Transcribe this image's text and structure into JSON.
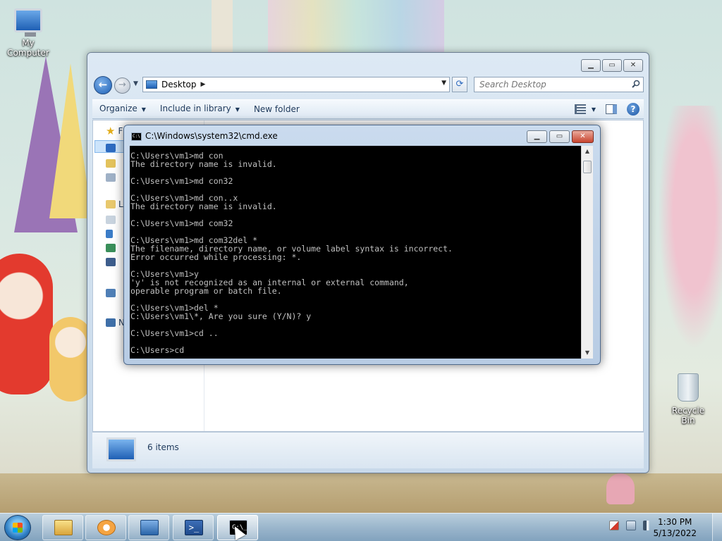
{
  "desktop": {
    "icons": [
      {
        "label": "My Computer",
        "icon": "computer-icon"
      },
      {
        "label": "Recycle Bin",
        "icon": "recycle-bin-icon"
      }
    ]
  },
  "explorer": {
    "address": {
      "location": "Desktop"
    },
    "search": {
      "placeholder": "Search Desktop"
    },
    "toolbar": {
      "organize": "Organize",
      "include_in_library": "Include in library",
      "new_folder": "New folder"
    },
    "navpane": {
      "favorites_letter": "F",
      "libraries_letter": "L",
      "network_letter": "N"
    },
    "details": {
      "item_count": "6 items"
    }
  },
  "cmd": {
    "title": "C:\\Windows\\system32\\cmd.exe",
    "output": "C:\\Users\\vm1>md con\nThe directory name is invalid.\n\nC:\\Users\\vm1>md con32\n\nC:\\Users\\vm1>md con..x\nThe directory name is invalid.\n\nC:\\Users\\vm1>md com32\n\nC:\\Users\\vm1>md com32del *\nThe filename, directory name, or volume label syntax is incorrect.\nError occurred while processing: *.\n\nC:\\Users\\vm1>y\n'y' is not recognized as an internal or external command,\noperable program or batch file.\n\nC:\\Users\\vm1>del *\nC:\\Users\\vm1\\*, Are you sure (Y/N)? y\n\nC:\\Users\\vm1>cd ..\n\nC:\\Users>cd"
  },
  "taskbar": {
    "apps": [
      {
        "name": "windows-explorer",
        "icon": "folder-icon"
      },
      {
        "name": "media-player",
        "icon": "media-player-icon"
      },
      {
        "name": "remote-desktop",
        "icon": "remote-desktop-icon"
      },
      {
        "name": "powershell",
        "icon": "powershell-icon",
        "glyph": ">_"
      },
      {
        "name": "command-prompt",
        "icon": "cmd-icon",
        "glyph": "C:\\_"
      }
    ],
    "clock": {
      "time": "1:30 PM",
      "date": "5/13/2022"
    }
  }
}
